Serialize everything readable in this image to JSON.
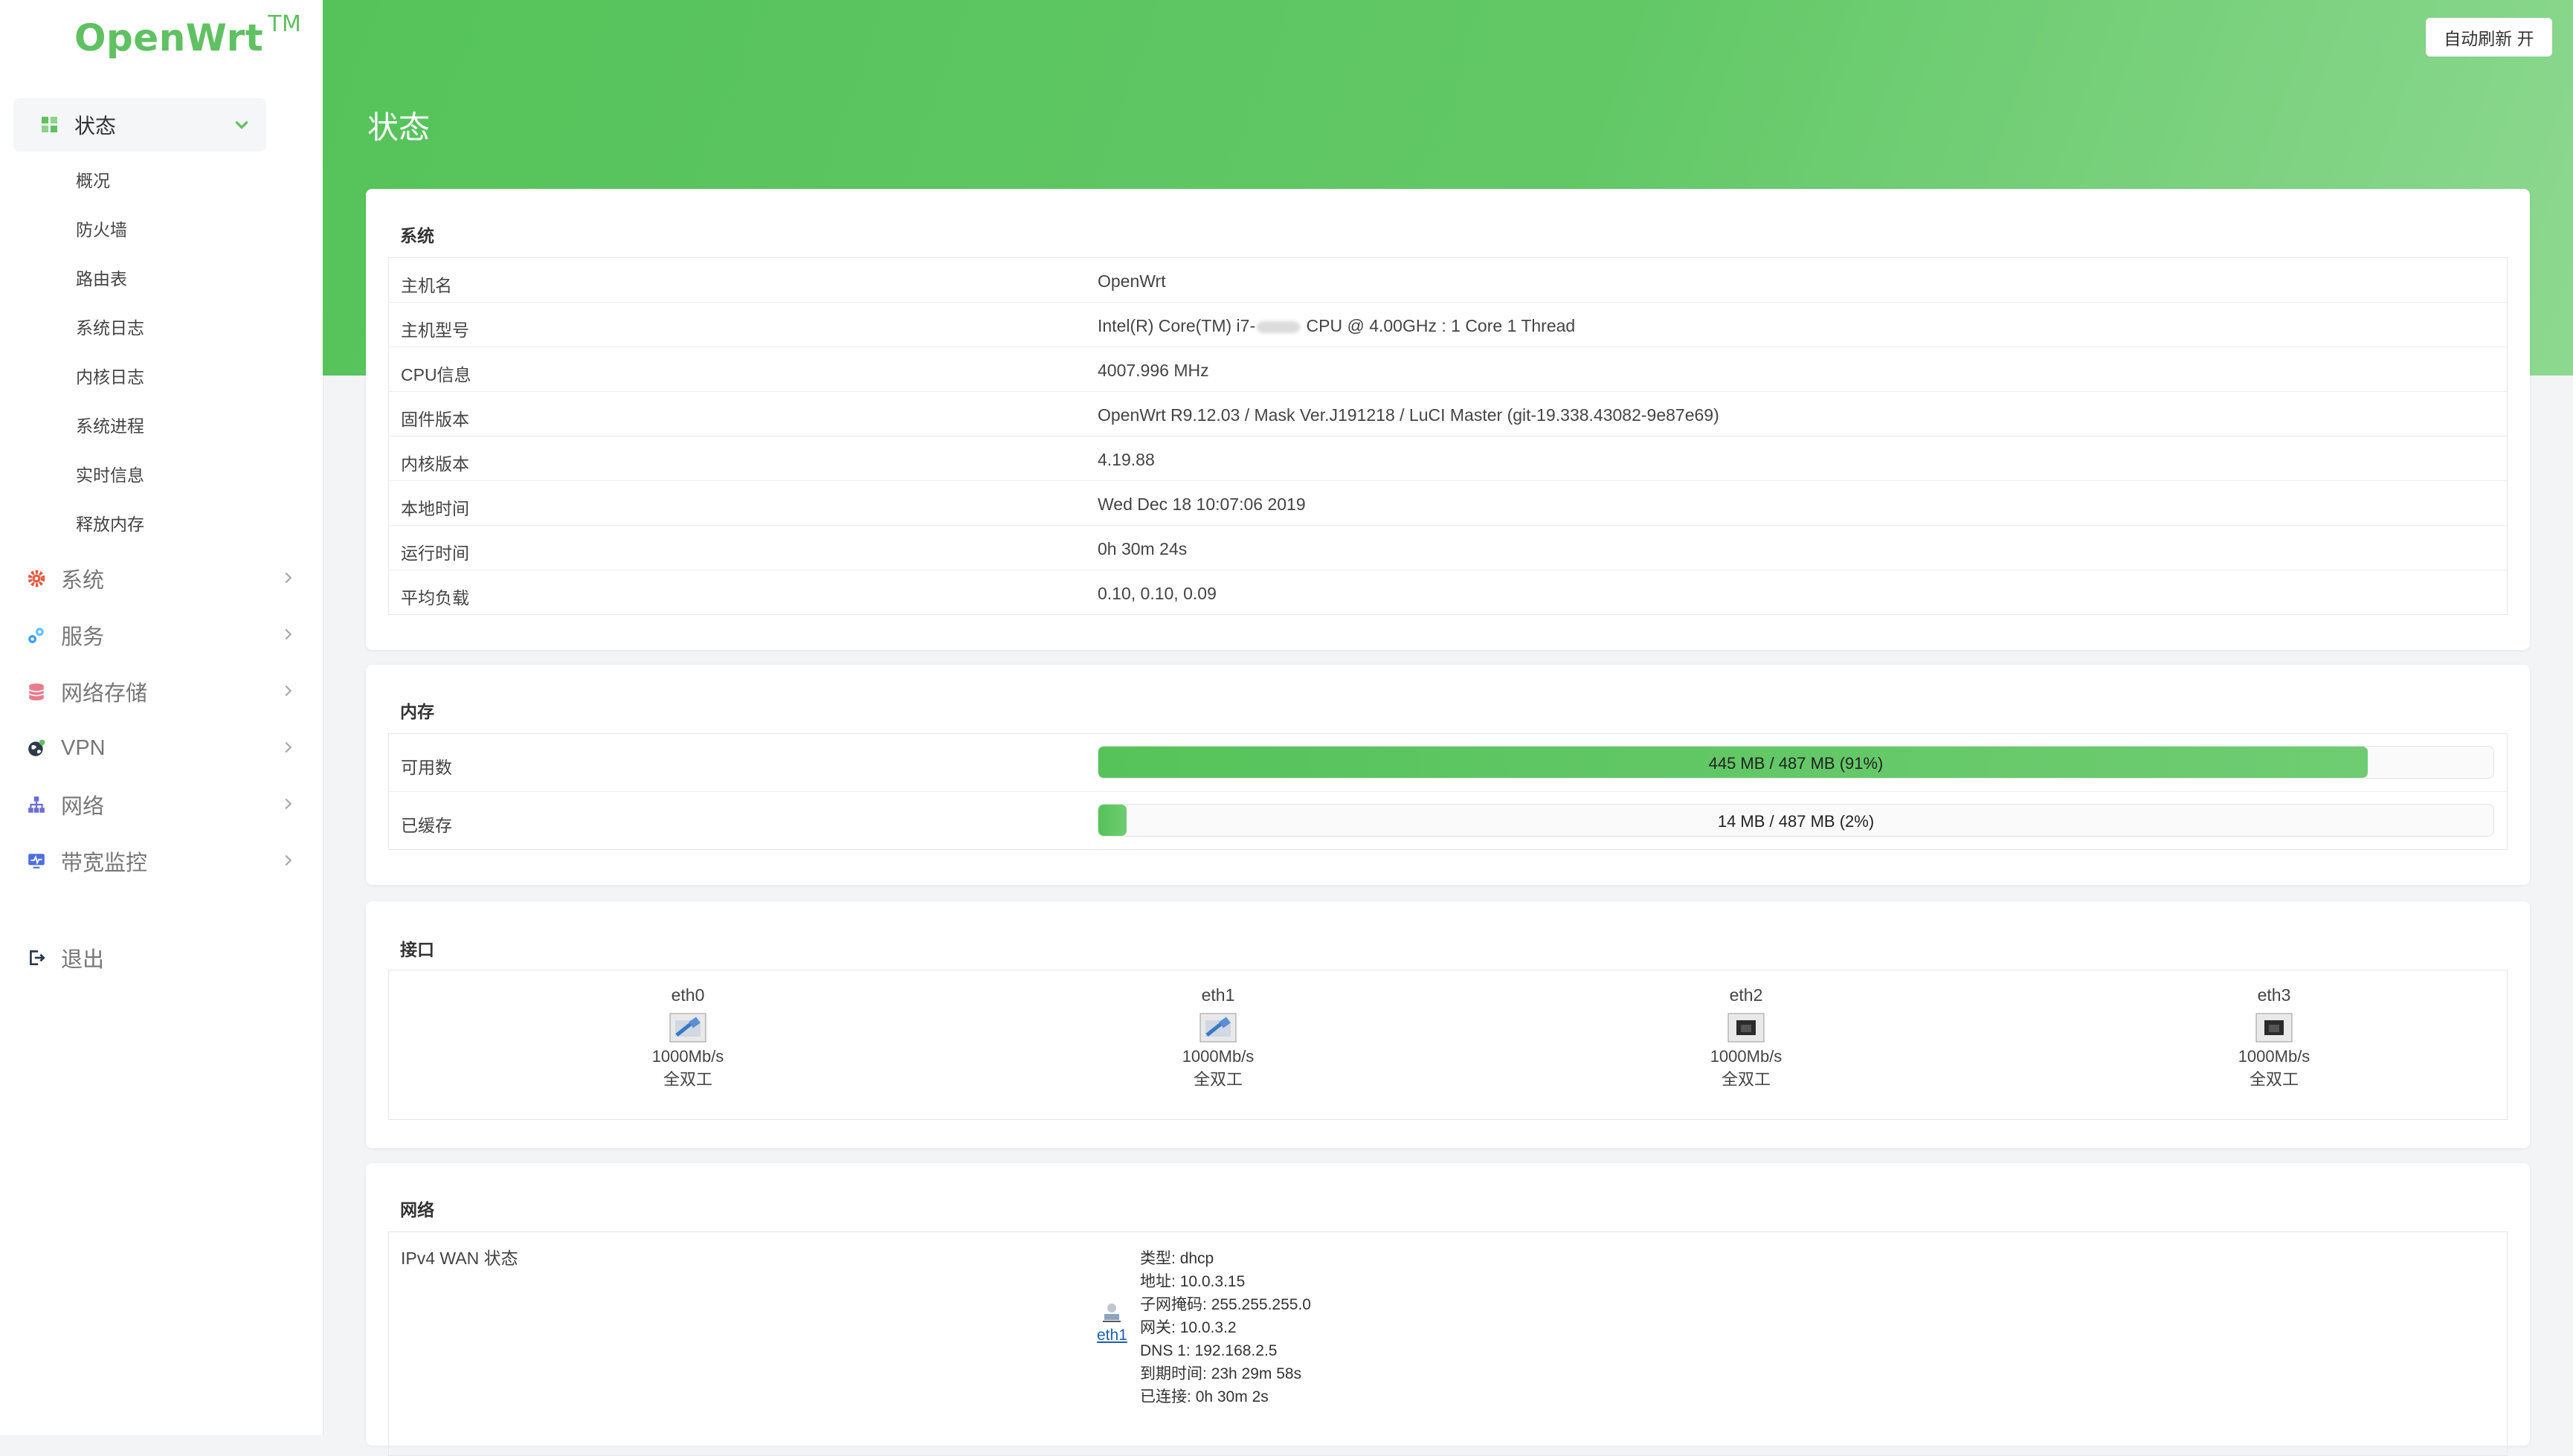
{
  "app": {
    "logo": "OpenWrt",
    "logo_tm": "TM",
    "accent_color": "#5fc161"
  },
  "sidebar": {
    "active": {
      "label": "状态",
      "icon": "dashboard-icon"
    },
    "sub_items": [
      "概况",
      "防火墙",
      "路由表",
      "系统日志",
      "内核日志",
      "系统进程",
      "实时信息",
      "释放内存"
    ],
    "items": [
      {
        "label": "系统",
        "icon": "gear-icon",
        "color": "#e8573f"
      },
      {
        "label": "服务",
        "icon": "services-icon",
        "color": "#3a9ff5"
      },
      {
        "label": "网络存储",
        "icon": "database-icon",
        "color": "#e87c8a"
      },
      {
        "label": "VPN",
        "icon": "globe-icon",
        "color": "#2d3a4b"
      },
      {
        "label": "网络",
        "icon": "network-icon",
        "color": "#6b6bd8"
      },
      {
        "label": "带宽监控",
        "icon": "monitor-icon",
        "color": "#4c6fe0"
      }
    ],
    "logout": {
      "label": "退出",
      "icon": "logout-icon"
    }
  },
  "header": {
    "title": "状态",
    "refresh_button": "自动刷新 开"
  },
  "system": {
    "title": "系统",
    "rows": [
      {
        "key": "主机名",
        "value": "OpenWrt"
      },
      {
        "key": "主机型号",
        "value_pre": "Intel(R) Core(TM) i7-",
        "value_post": " CPU @ 4.00GHz : 1 Core 1 Thread"
      },
      {
        "key": "CPU信息",
        "value": "4007.996 MHz"
      },
      {
        "key": "固件版本",
        "value": "OpenWrt R9.12.03 / Mask Ver.J191218 / LuCI Master (git-19.338.43082-9e87e69)"
      },
      {
        "key": "内核版本",
        "value": "4.19.88"
      },
      {
        "key": "本地时间",
        "value": "Wed Dec 18 10:07:06 2019"
      },
      {
        "key": "运行时间",
        "value": "0h 30m 24s"
      },
      {
        "key": "平均负载",
        "value": "0.10, 0.10, 0.09"
      }
    ]
  },
  "memory": {
    "title": "内存",
    "rows": [
      {
        "key": "可用数",
        "label": "445 MB / 487 MB (91%)",
        "percent": 91
      },
      {
        "key": "已缓存",
        "label": "14 MB / 487 MB (2%)",
        "percent": 2
      }
    ]
  },
  "interfaces": {
    "title": "接口",
    "ports": [
      {
        "name": "eth0",
        "speed": "1000Mb/s",
        "duplex": "全双工",
        "icon": "ethernet-connected-icon"
      },
      {
        "name": "eth1",
        "speed": "1000Mb/s",
        "duplex": "全双工",
        "icon": "ethernet-connected-icon"
      },
      {
        "name": "eth2",
        "speed": "1000Mb/s",
        "duplex": "全双工",
        "icon": "ethernet-port-icon"
      },
      {
        "name": "eth3",
        "speed": "1000Mb/s",
        "duplex": "全双工",
        "icon": "ethernet-port-icon"
      }
    ]
  },
  "network": {
    "title": "网络",
    "wan_label": "IPv4 WAN 状态",
    "link": "eth1",
    "details": [
      {
        "label": "类型:",
        "value": "dhcp"
      },
      {
        "label": "地址:",
        "value": "10.0.3.15"
      },
      {
        "label": "子网掩码:",
        "value": "255.255.255.0"
      },
      {
        "label": "网关:",
        "value": "10.0.3.2"
      },
      {
        "label": "DNS 1:",
        "value": "192.168.2.5"
      },
      {
        "label": "到期时间:",
        "value": "23h 29m 58s"
      },
      {
        "label": "已连接:",
        "value": "0h 30m 2s"
      }
    ]
  }
}
